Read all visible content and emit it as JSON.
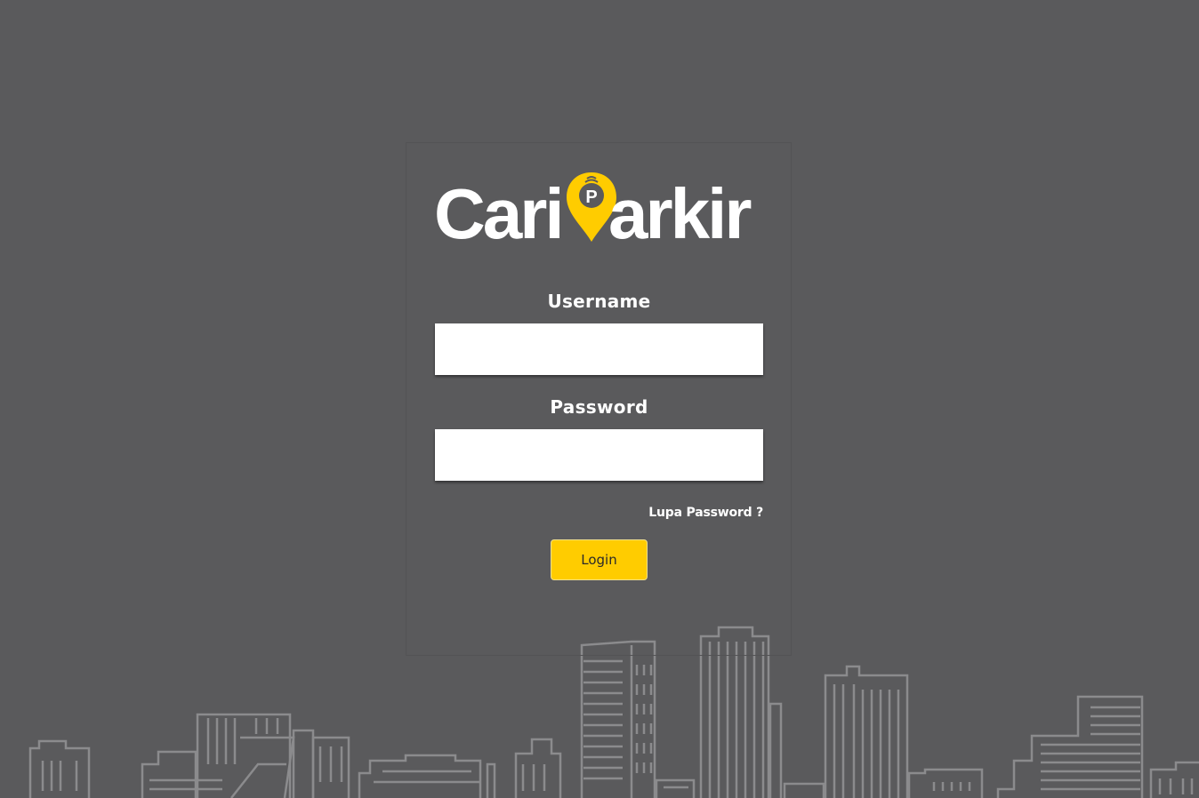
{
  "brand": {
    "name": "CariParkir",
    "prefix": "Cari",
    "suffix": "arkir",
    "pin_letter": "P"
  },
  "form": {
    "username_label": "Username",
    "username_value": "",
    "password_label": "Password",
    "password_value": "",
    "forgot_link": "Lupa Password ?",
    "login_button": "Login"
  },
  "colors": {
    "background": "#5a5a5c",
    "accent": "#ffcc00",
    "text": "#ffffff",
    "skyline": "#8b8b8d"
  },
  "icons": {
    "logo_pin": "parking-pin-icon",
    "skyline": "city-skyline-illustration"
  }
}
